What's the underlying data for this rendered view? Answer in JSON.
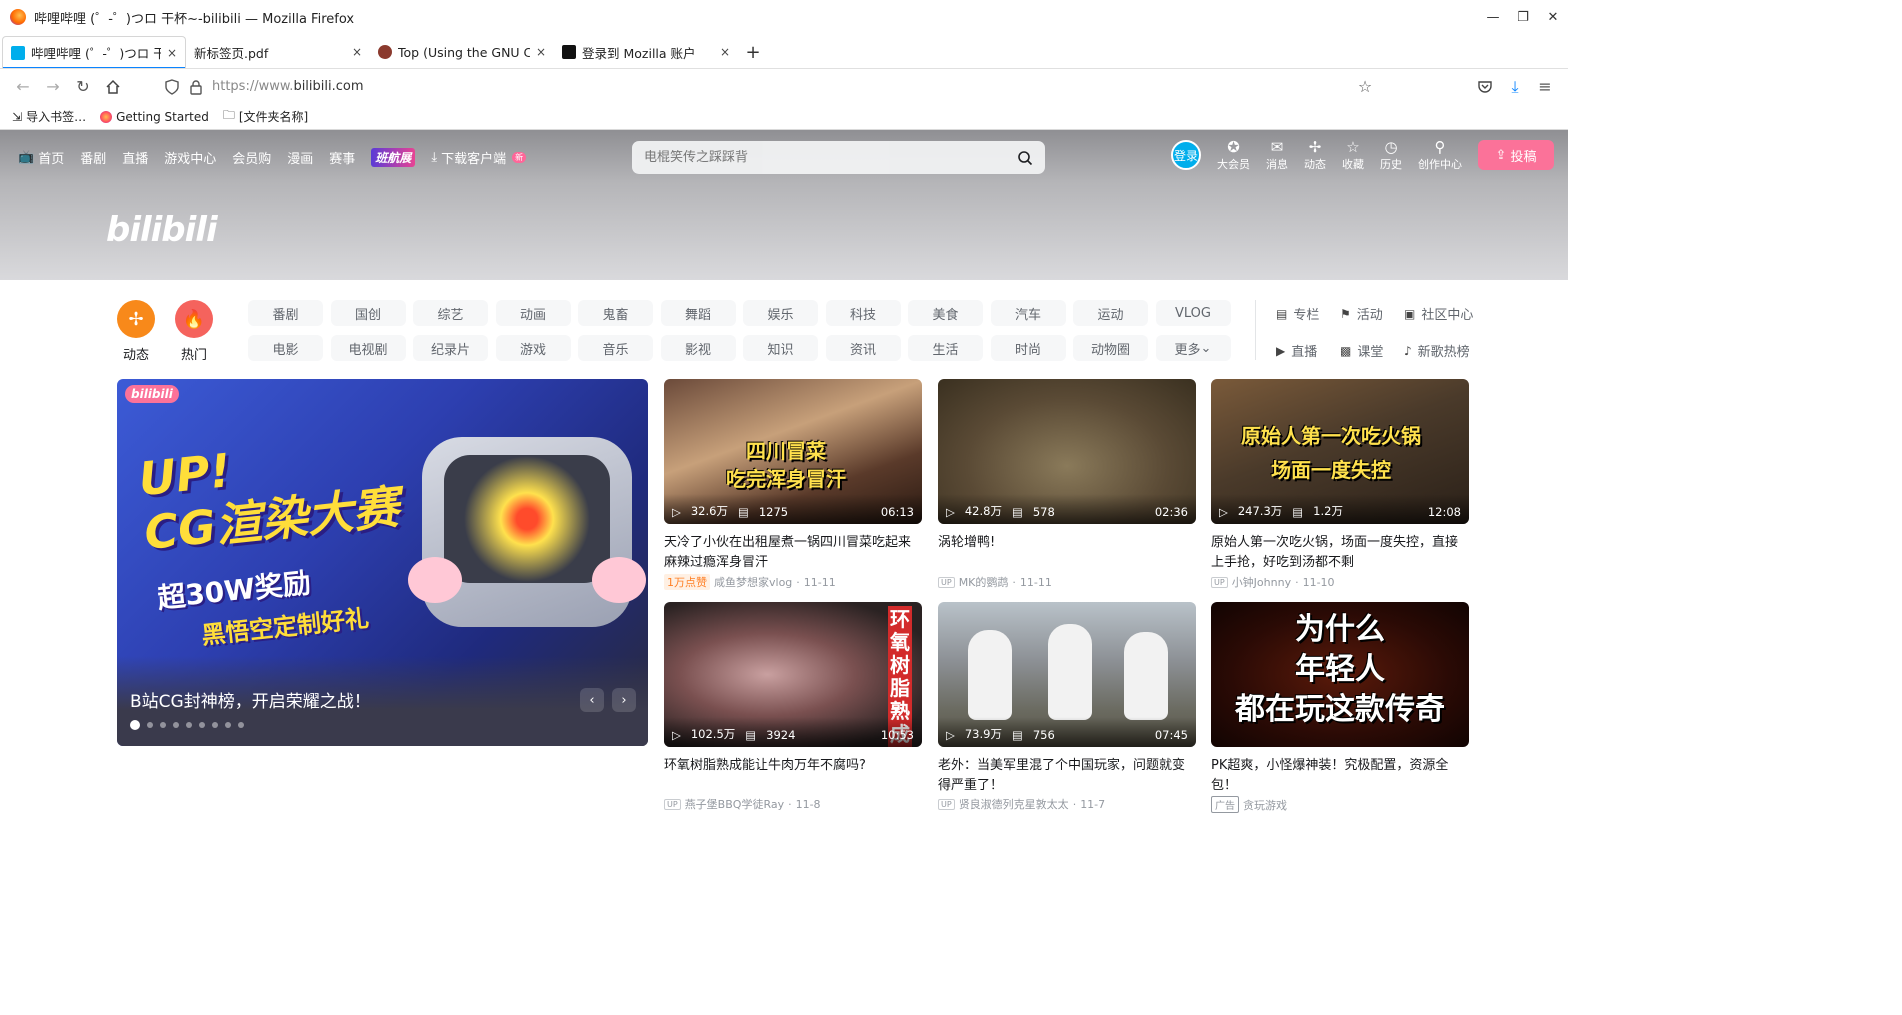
{
  "window": {
    "title": "哔哩哔哩 (゜-゜)つロ 干杯~-bilibili — Mozilla Firefox"
  },
  "tabs": [
    {
      "label": "哔哩哔哩 (゜-゜)つロ 干杯~-bilibili",
      "close": "×"
    },
    {
      "label": "新标签页.pdf",
      "close": "×"
    },
    {
      "label": "Top (Using the GNU Compiler Collection)",
      "close": "×"
    },
    {
      "label": "登录到 Mozilla 账户",
      "close": "×"
    }
  ],
  "newtab": "+",
  "url": "https://www.bilibili.com",
  "url_prefix": "https://www.",
  "url_domain": "bilibili.com",
  "bookmarks": [
    {
      "label": "导入书签…"
    },
    {
      "label": "Getting Started"
    },
    {
      "label": "[文件夹名称]"
    }
  ],
  "bili_nav": {
    "left": [
      "首页",
      "番剧",
      "直播",
      "游戏中心",
      "会员购",
      "漫画",
      "赛事"
    ],
    "event_label": "班航展",
    "download": "下载客户端",
    "new_badge": "新"
  },
  "search": {
    "placeholder": "电棍笑传之踩踩背"
  },
  "bili_right": {
    "login": "登录",
    "items": [
      "大会员",
      "消息",
      "动态",
      "收藏",
      "历史",
      "创作中心"
    ],
    "upload": "投稿"
  },
  "logo_text": "bilibili",
  "channels": {
    "circle1": "动态",
    "circle2": "热门",
    "chips": [
      "番剧",
      "国创",
      "综艺",
      "动画",
      "鬼畜",
      "舞蹈",
      "娱乐",
      "科技",
      "美食",
      "汽车",
      "运动",
      "VLOG",
      "电影",
      "电视剧",
      "纪录片",
      "游戏",
      "音乐",
      "影视",
      "知识",
      "资讯",
      "生活",
      "时尚",
      "动物圈",
      "更多"
    ],
    "links": [
      "专栏",
      "活动",
      "社区中心",
      "直播",
      "课堂",
      "新歌热榜"
    ]
  },
  "carousel": {
    "badge": "bilibili",
    "title_line1": "UP!",
    "title_line2": "CG渲染大赛",
    "sub1": "超30W奖励",
    "sub2": "黑悟空定制好礼",
    "caption": "B站CG封神榜，开启荣耀之战！",
    "prev": "‹",
    "next": "›",
    "dots_total": 9,
    "active_dot": 1
  },
  "cards": [
    {
      "views": "32.6万",
      "danmaku": "1275",
      "duration": "06:13",
      "overlay": "四川冒菜\n吃完浑身冒汗",
      "title": "天冷了小伙在出租屋煮一锅四川冒菜吃起来麻辣过瘾浑身冒汗",
      "hot": "1万点赞",
      "author": "咸鱼梦想家vlog",
      "date": "11-11"
    },
    {
      "views": "42.8万",
      "danmaku": "578",
      "duration": "02:36",
      "overlay": "",
      "title": "涡轮增鸭!",
      "author": "MK的鹦鹉",
      "date": "11-11"
    },
    {
      "views": "247.3万",
      "danmaku": "1.2万",
      "duration": "12:08",
      "overlay": "原始人第一次吃火锅\n场面一度失控",
      "title": "原始人第一次吃火锅，场面一度失控，直接上手抢，好吃到汤都不剩",
      "author": "小钟Johnny",
      "date": "11-10"
    },
    {
      "views": "102.5万",
      "danmaku": "3924",
      "duration": "10:53",
      "overlay": "环氧树脂熟成",
      "title": "环氧树脂熟成能让牛肉万年不腐吗?",
      "author": "燕子堡BBQ学徒Ray",
      "date": "11-8"
    },
    {
      "views": "73.9万",
      "danmaku": "756",
      "duration": "07:45",
      "overlay": "",
      "title": "老外：当美军里混了个中国玩家，问题就变得严重了！",
      "author": "贤良淑德列克星敦太太",
      "date": "11-7"
    },
    {
      "overlay": "为什么\n年轻人\n都在玩这款传奇",
      "title": "PK超爽，小怪爆神装！究极配置，资源全包！",
      "ad": "广告",
      "author": "贪玩游戏"
    }
  ],
  "sep": "·",
  "colors": {
    "bili_pink": "#fb7299",
    "bili_blue": "#00aeec",
    "orange": "#f8891a",
    "red_hot": "#f5635d"
  }
}
